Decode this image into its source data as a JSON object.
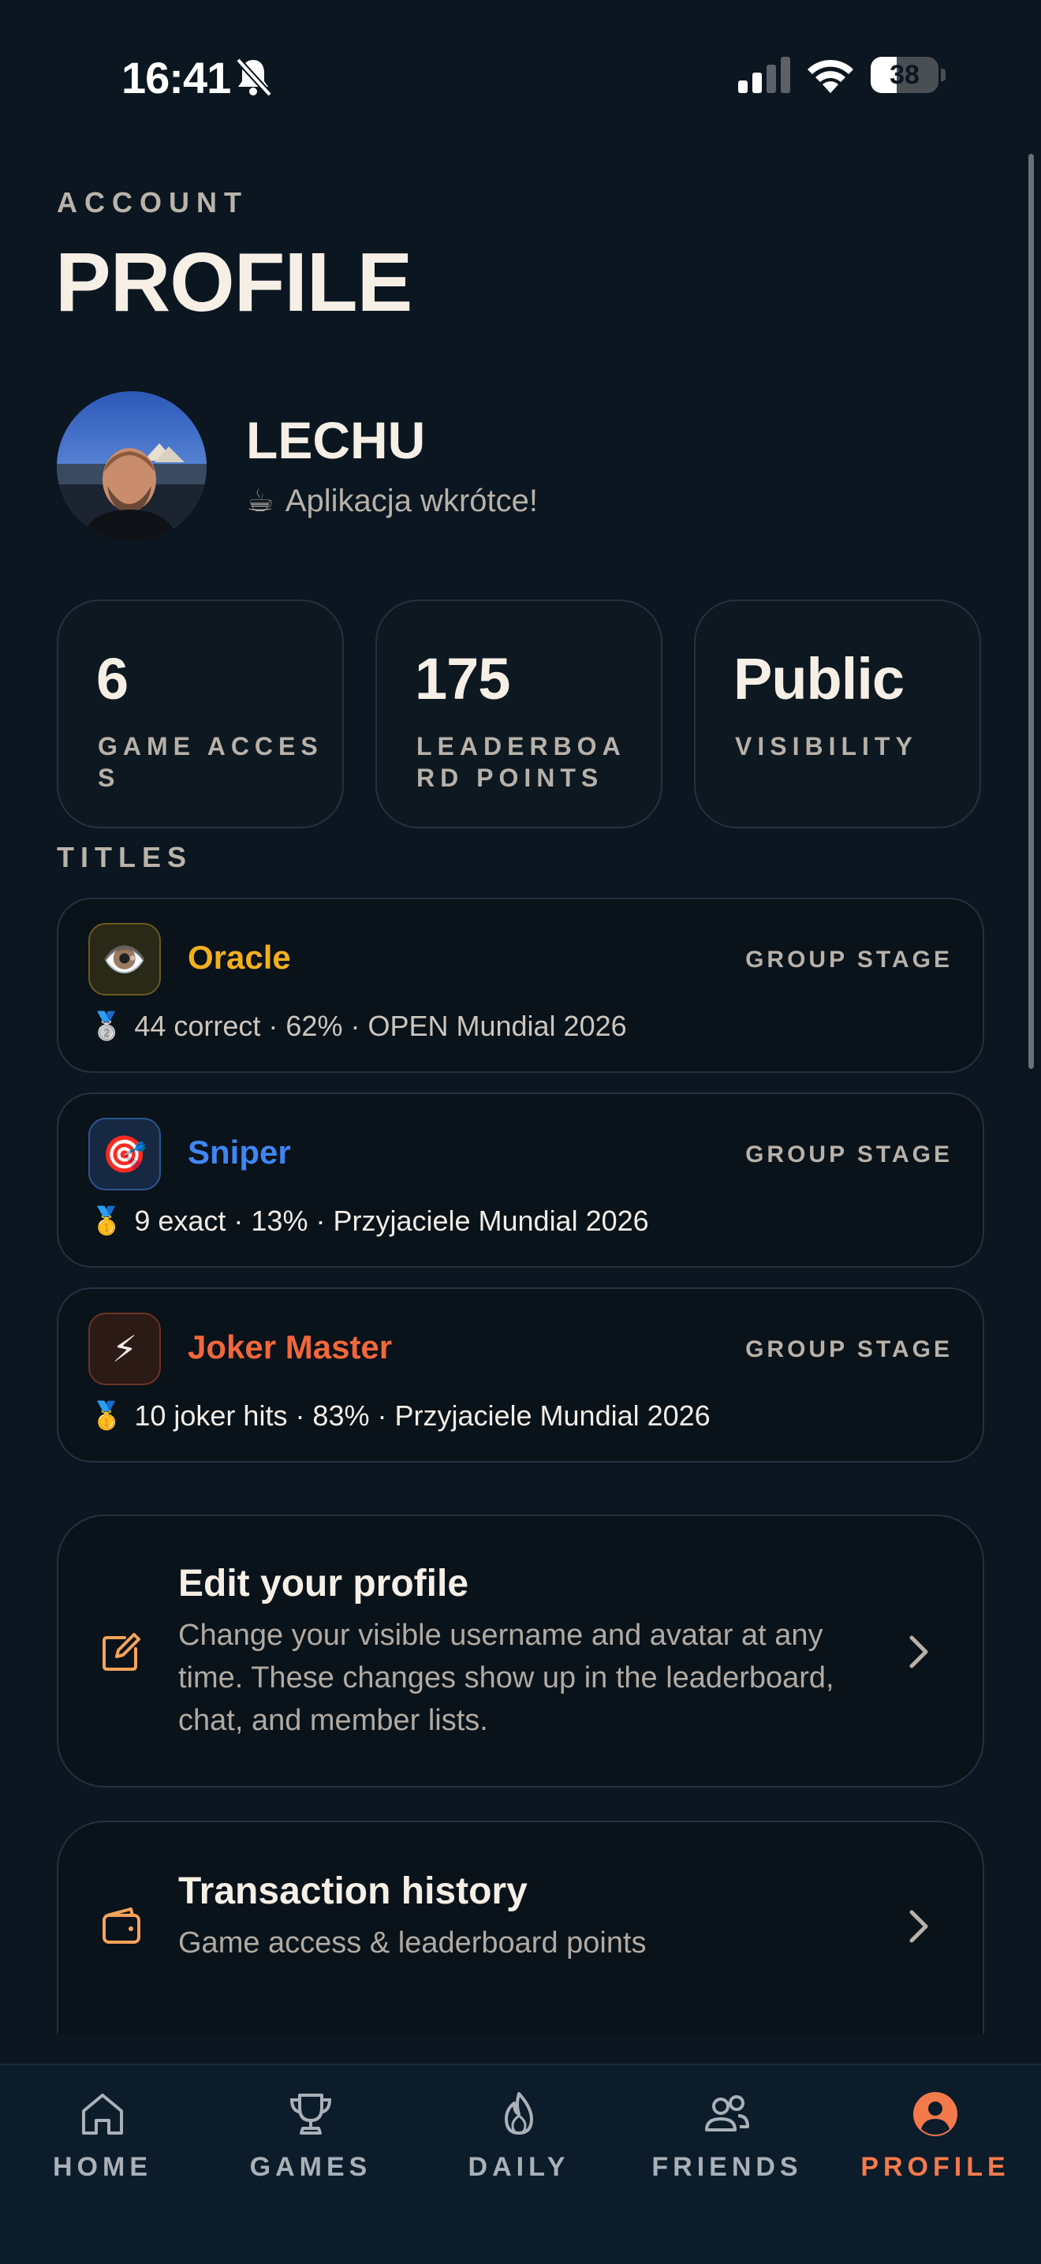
{
  "status_bar": {
    "time": "16:41",
    "battery": "38",
    "battery_level": 0.38,
    "icons": [
      "bell-slash-icon",
      "signal-icon",
      "wifi-icon",
      "battery-icon"
    ]
  },
  "header": {
    "section": "ACCOUNT",
    "title": "PROFILE"
  },
  "user": {
    "name": "LECHU",
    "status_emoji": "☕",
    "status": "Aplikacja wkrótce!"
  },
  "stats": [
    {
      "value": "6",
      "label": "GAME ACCESS"
    },
    {
      "value": "175",
      "label": "LEADERBOARD POINTS"
    },
    {
      "value": "Public",
      "label": "VISIBILITY"
    }
  ],
  "titles_label": "TITLES",
  "titles": [
    {
      "icon": "👁️",
      "icon_name": "eye-icon",
      "name": "Oracle",
      "color": "#f2b01e",
      "stage": "GROUP STAGE",
      "medal": "🥈",
      "detail": "44 correct · 62% · OPEN Mundial 2026"
    },
    {
      "icon": "🎯",
      "icon_name": "target-icon",
      "name": "Sniper",
      "color": "#3f86f2",
      "stage": "GROUP STAGE",
      "medal": "🥇",
      "detail": "9 exact · 13% · Przyjaciele Mundial 2026"
    },
    {
      "icon": "⚡",
      "icon_name": "lightning-icon",
      "name": "Joker Master",
      "color": "#f2673a",
      "stage": "GROUP STAGE",
      "medal": "🥇",
      "detail": "10 joker hits · 83% · Przyjaciele Mundial 2026"
    }
  ],
  "actions": {
    "edit_profile": {
      "title": "Edit your profile",
      "description": "Change your visible username and avatar at any time. These changes show up in the leaderboard, chat, and member lists."
    },
    "transaction_history": {
      "title": "Transaction history",
      "description": "Game access & leaderboard points"
    }
  },
  "tabs": [
    {
      "label": "HOME",
      "icon": "home-icon"
    },
    {
      "label": "GAMES",
      "icon": "trophy-icon"
    },
    {
      "label": "DAILY",
      "icon": "flame-icon"
    },
    {
      "label": "FRIENDS",
      "icon": "friends-icon"
    },
    {
      "label": "PROFILE",
      "icon": "profile-icon",
      "active": true
    }
  ],
  "colors": {
    "background": "#0b1620",
    "accent": "#f47a4c",
    "tab_bar": "#0d1c2a",
    "card_border": "#233140"
  }
}
